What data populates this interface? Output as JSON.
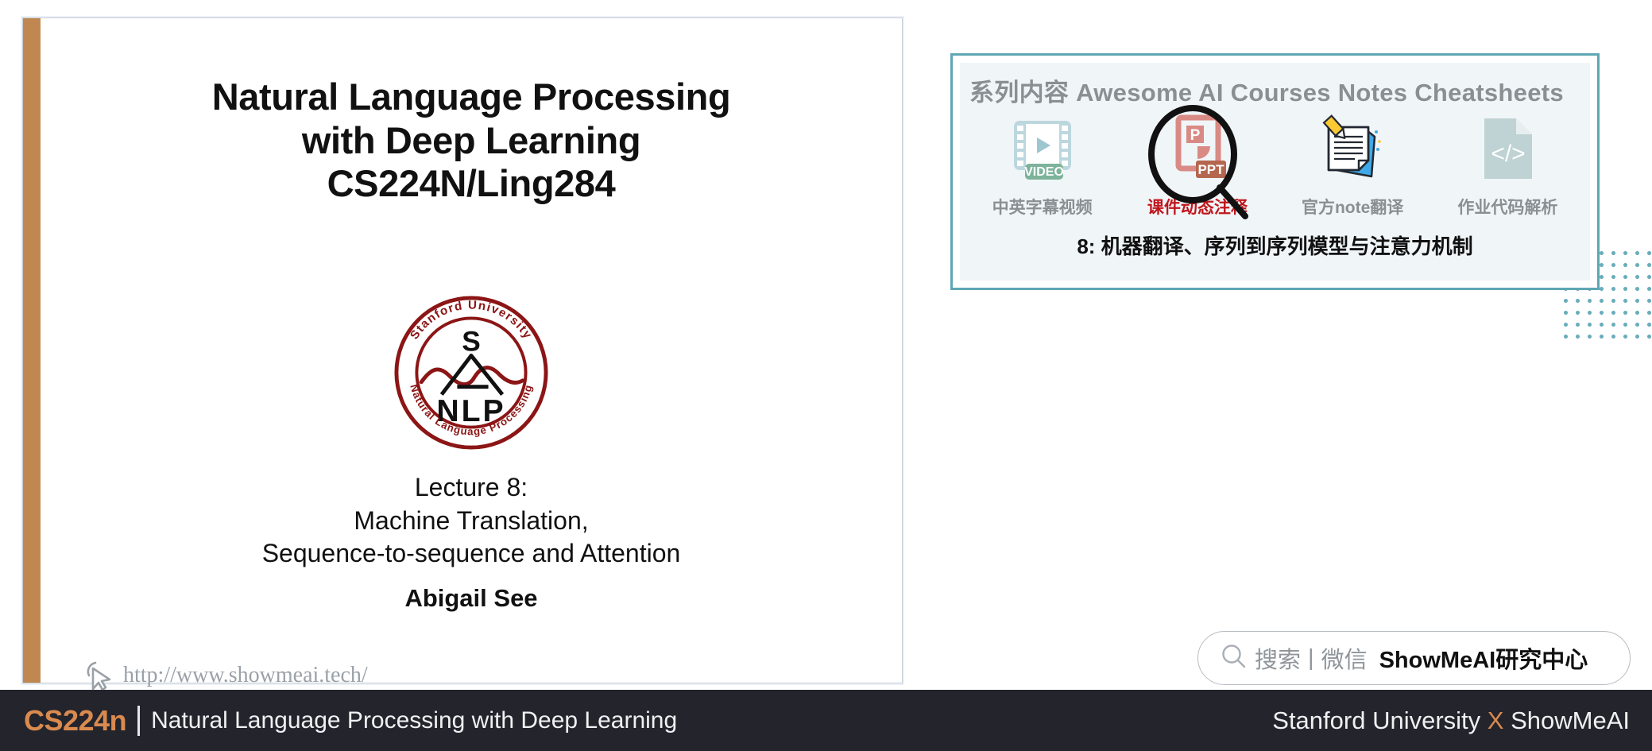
{
  "slide": {
    "title_lines": [
      "Natural Language Processing",
      "with Deep Learning",
      "CS224N/Ling284"
    ],
    "logo": {
      "top_arc_text": "Stanford University",
      "bottom_arc_text": "Natural Language Processing",
      "center_letter": "S",
      "center_word": "NLP",
      "color": "#8C1515"
    },
    "lecture_lines": [
      "Lecture 8:",
      "Machine Translation,",
      "Sequence-to-sequence and Attention"
    ],
    "author": "Abigail See",
    "site_credit": "http://www.showmeai.tech/",
    "accent_bar_color": "#c08850"
  },
  "promo": {
    "heading": "系列内容 Awesome AI Courses Notes Cheatsheets",
    "border_color": "#5fa6b4",
    "highlight_color": "#c0161c",
    "items": [
      {
        "icon": "video-film-icon",
        "badge": "VIDEO",
        "label": "中英字幕视频",
        "highlighted": false
      },
      {
        "icon": "ppt-slide-icon",
        "badge": "PPT",
        "label": "课件动态注释",
        "highlighted": true
      },
      {
        "icon": "note-pencil-icon",
        "badge": "",
        "label": "官方note翻译",
        "highlighted": false
      },
      {
        "icon": "code-file-icon",
        "badge": "",
        "label": "作业代码解析",
        "highlighted": false
      }
    ],
    "subtitle": "8: 机器翻译、序列到序列模型与注意力机制"
  },
  "search": {
    "query_label": "搜索",
    "separator": "|",
    "channel_label": "微信",
    "brand": "ShowMeAI研究中心"
  },
  "bottom_bar": {
    "course_code": "CS224n",
    "course_subtitle": "Natural Language Processing with Deep Learning",
    "partner_left": "Stanford University",
    "partner_x": "X",
    "partner_right": "ShowMeAI",
    "background": "#23242c",
    "accent": "#d98a4f"
  }
}
